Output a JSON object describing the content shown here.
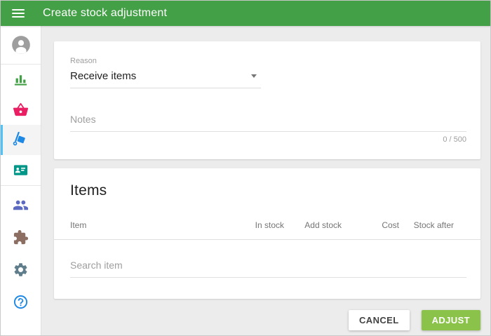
{
  "header": {
    "title": "Create stock adjustment"
  },
  "sidebar": {
    "icons": [
      "account-icon",
      "bar-chart-icon",
      "basket-icon",
      "hand-truck-icon",
      "contact-card-icon",
      "people-icon",
      "puzzle-icon",
      "gear-icon",
      "help-icon"
    ],
    "selected_icon": "hand-truck-icon"
  },
  "form": {
    "reason": {
      "label": "Reason",
      "value": "Receive items"
    },
    "notes": {
      "placeholder": "Notes",
      "counter": "0 / 500"
    }
  },
  "items": {
    "title": "Items",
    "columns": [
      "Item",
      "In stock",
      "Add stock",
      "Cost",
      "Stock after"
    ],
    "search_placeholder": "Search item"
  },
  "actions": {
    "cancel_label": "CANCEL",
    "adjust_label": "ADJUST"
  },
  "colors": {
    "header_green": "#43A047",
    "adjust_button_green": "#8BC34A",
    "selected_indicator_blue": "#4FC3F7",
    "reports_icon_green": "#43A047",
    "basket_icon_pink": "#E91E63",
    "truck_icon_blue": "#1E88E5",
    "contact_card_icon_teal": "#009688",
    "people_icon_indigo": "#5C6BC0",
    "puzzle_icon_brown": "#8D6E63",
    "gear_icon_bluegray": "#607D8B",
    "help_icon_blue": "#1E88E5",
    "avatar_gray": "#9E9E9E",
    "content_background": "#ECECEC"
  }
}
